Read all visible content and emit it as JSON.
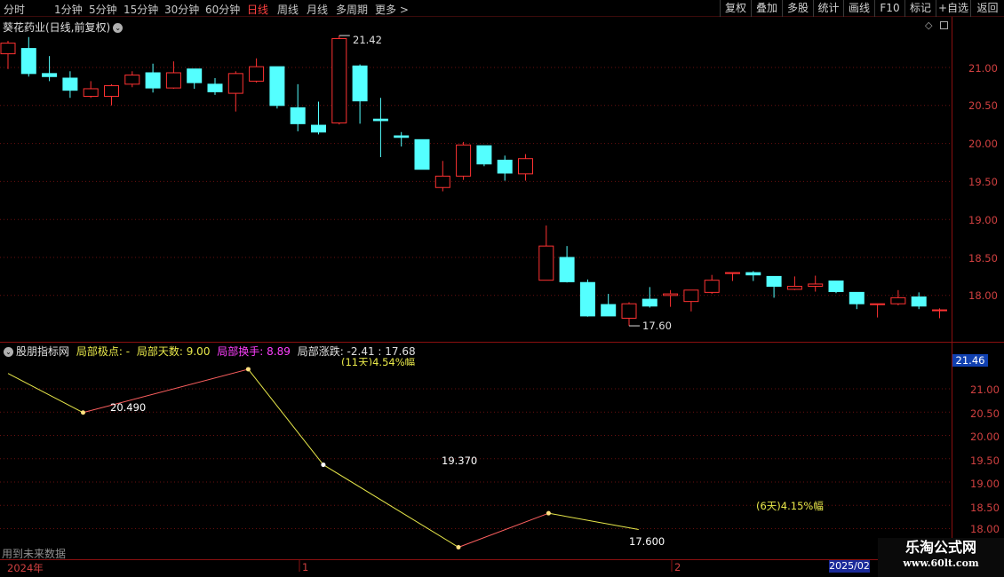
{
  "toolbar": {
    "periods": [
      "分时",
      "1分钟",
      "5分钟",
      "15分钟",
      "30分钟",
      "60分钟",
      "日线",
      "周线",
      "月线",
      "多周期",
      "更多 >"
    ],
    "active_period": "日线",
    "tools": [
      "复权",
      "叠加",
      "多股",
      "统计",
      "画线",
      "F10",
      "标记",
      "+自选",
      "返回"
    ]
  },
  "main_chart": {
    "title": "葵花药业(日线,前复权)",
    "y_ticks": [
      "21.00",
      "20.50",
      "20.00",
      "19.50",
      "19.00",
      "18.50",
      "18.00"
    ],
    "high_label": "21.42",
    "low_label": "17.60"
  },
  "indicator": {
    "name": "股朋指标网",
    "local_extreme": "局部极点: -",
    "local_days": "局部天数: 9.00",
    "local_turnover": "局部换手: 8.89",
    "local_change": "局部涨跌: -2.41 : 17.68",
    "y_ticks": [
      "21.00",
      "20.50",
      "20.00",
      "19.50",
      "19.00",
      "18.50",
      "18.00"
    ],
    "price_badge": "21.46",
    "labels": {
      "p1": "20.490",
      "p2": "(11天)4.54%幅",
      "p3": "19.370",
      "p4": "17.600",
      "p5": "(6天)4.15%幅"
    },
    "future_note": "用到未来数据"
  },
  "colors": {
    "up": "#ff3232",
    "down": "#54ffff",
    "indicator_yellow": "#e8e84a",
    "indicator_red": "#ff6060",
    "axis": "#8a1010"
  },
  "chart_data": {
    "type": "candlestick",
    "candles": [
      {
        "o": 21.18,
        "h": 21.35,
        "l": 20.98,
        "c": 21.32
      },
      {
        "o": 21.25,
        "h": 21.4,
        "l": 20.88,
        "c": 20.92
      },
      {
        "o": 20.92,
        "h": 21.15,
        "l": 20.82,
        "c": 20.88
      },
      {
        "o": 20.86,
        "h": 20.95,
        "l": 20.6,
        "c": 20.7
      },
      {
        "o": 20.62,
        "h": 20.82,
        "l": 20.6,
        "c": 20.72
      },
      {
        "o": 20.62,
        "h": 20.78,
        "l": 20.5,
        "c": 20.76
      },
      {
        "o": 20.78,
        "h": 20.95,
        "l": 20.74,
        "c": 20.9
      },
      {
        "o": 20.93,
        "h": 21.05,
        "l": 20.67,
        "c": 20.73
      },
      {
        "o": 20.73,
        "h": 21.08,
        "l": 20.72,
        "c": 20.93
      },
      {
        "o": 20.98,
        "h": 20.98,
        "l": 20.72,
        "c": 20.8
      },
      {
        "o": 20.78,
        "h": 20.86,
        "l": 20.64,
        "c": 20.68
      },
      {
        "o": 20.66,
        "h": 20.95,
        "l": 20.42,
        "c": 20.92
      },
      {
        "o": 20.82,
        "h": 21.12,
        "l": 20.8,
        "c": 21.01
      },
      {
        "o": 21.01,
        "h": 21.01,
        "l": 20.46,
        "c": 20.5
      },
      {
        "o": 20.47,
        "h": 20.78,
        "l": 20.16,
        "c": 20.26
      },
      {
        "o": 20.24,
        "h": 20.55,
        "l": 20.12,
        "c": 20.15
      },
      {
        "o": 20.27,
        "h": 21.42,
        "l": 20.25,
        "c": 21.38
      },
      {
        "o": 21.02,
        "h": 21.04,
        "l": 20.26,
        "c": 20.56
      },
      {
        "o": 20.32,
        "h": 20.6,
        "l": 19.82,
        "c": 20.3
      },
      {
        "o": 20.1,
        "h": 20.15,
        "l": 19.96,
        "c": 20.08
      },
      {
        "o": 20.05,
        "h": 20.05,
        "l": 19.66,
        "c": 19.66
      },
      {
        "o": 19.42,
        "h": 19.77,
        "l": 19.37,
        "c": 19.57
      },
      {
        "o": 19.57,
        "h": 20.02,
        "l": 19.52,
        "c": 19.98
      },
      {
        "o": 19.97,
        "h": 19.97,
        "l": 19.7,
        "c": 19.73
      },
      {
        "o": 19.78,
        "h": 19.84,
        "l": 19.51,
        "c": 19.61
      },
      {
        "o": 19.6,
        "h": 19.86,
        "l": 19.51,
        "c": 19.8
      },
      {
        "o": 18.2,
        "h": 18.92,
        "l": 18.2,
        "c": 18.65
      },
      {
        "o": 18.5,
        "h": 18.65,
        "l": 18.17,
        "c": 18.18
      },
      {
        "o": 18.17,
        "h": 18.21,
        "l": 17.72,
        "c": 17.73
      },
      {
        "o": 17.88,
        "h": 18.02,
        "l": 17.73,
        "c": 17.73
      },
      {
        "o": 17.7,
        "h": 17.91,
        "l": 17.6,
        "c": 17.89
      },
      {
        "o": 17.95,
        "h": 18.11,
        "l": 17.84,
        "c": 17.86
      },
      {
        "o": 18.0,
        "h": 18.07,
        "l": 17.85,
        "c": 18.02
      },
      {
        "o": 17.92,
        "h": 18.07,
        "l": 17.79,
        "c": 18.07
      },
      {
        "o": 18.04,
        "h": 18.27,
        "l": 18.02,
        "c": 18.2
      },
      {
        "o": 18.29,
        "h": 18.3,
        "l": 18.19,
        "c": 18.3
      },
      {
        "o": 18.3,
        "h": 18.32,
        "l": 18.19,
        "c": 18.27
      },
      {
        "o": 18.25,
        "h": 18.25,
        "l": 17.97,
        "c": 18.12
      },
      {
        "o": 18.08,
        "h": 18.25,
        "l": 18.07,
        "c": 18.12
      },
      {
        "o": 18.12,
        "h": 18.26,
        "l": 18.05,
        "c": 18.15
      },
      {
        "o": 18.19,
        "h": 18.19,
        "l": 18.03,
        "c": 18.05
      },
      {
        "o": 18.04,
        "h": 18.04,
        "l": 17.82,
        "c": 17.89
      },
      {
        "o": 17.88,
        "h": 17.88,
        "l": 17.71,
        "c": 17.89
      },
      {
        "o": 17.89,
        "h": 18.07,
        "l": 17.87,
        "c": 17.97
      },
      {
        "o": 17.98,
        "h": 18.04,
        "l": 17.82,
        "c": 17.86
      },
      {
        "o": 17.81,
        "h": 17.83,
        "l": 17.7,
        "c": 17.81
      }
    ],
    "indicator_points": [
      {
        "i": 0,
        "v": 21.33
      },
      {
        "i": 5,
        "v": 20.49
      },
      {
        "i": 16,
        "v": 21.42
      },
      {
        "i": 21,
        "v": 19.37
      },
      {
        "i": 30,
        "v": 17.6
      },
      {
        "i": 36,
        "v": 18.33
      },
      {
        "i": 42,
        "v": 17.98
      }
    ],
    "x_labels": [
      "2024年",
      "1",
      "2",
      "2025/02"
    ]
  }
}
